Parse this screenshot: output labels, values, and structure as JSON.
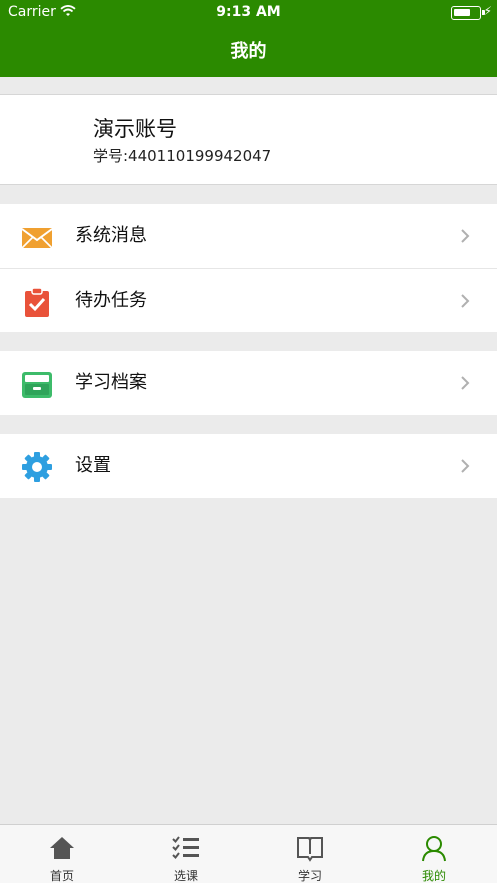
{
  "status_bar": {
    "carrier": "Carrier",
    "time": "9:13 AM"
  },
  "nav": {
    "title": "我的"
  },
  "profile": {
    "name": "演示账号",
    "student_id": "学号:440110199942047"
  },
  "menu_groups": [
    [
      {
        "label": "系统消息",
        "icon": "envelope-icon"
      },
      {
        "label": "待办任务",
        "icon": "clipboard-check-icon"
      }
    ],
    [
      {
        "label": "学习档案",
        "icon": "archive-box-icon"
      }
    ],
    [
      {
        "label": "设置",
        "icon": "gear-icon"
      }
    ]
  ],
  "tabs": [
    {
      "label": "首页",
      "icon": "home-icon"
    },
    {
      "label": "选课",
      "icon": "checklist-icon"
    },
    {
      "label": "学习",
      "icon": "book-icon"
    },
    {
      "label": "我的",
      "icon": "user-icon",
      "active": true
    }
  ],
  "colors": {
    "brand": "#2b8a00",
    "background": "#ebebeb"
  }
}
